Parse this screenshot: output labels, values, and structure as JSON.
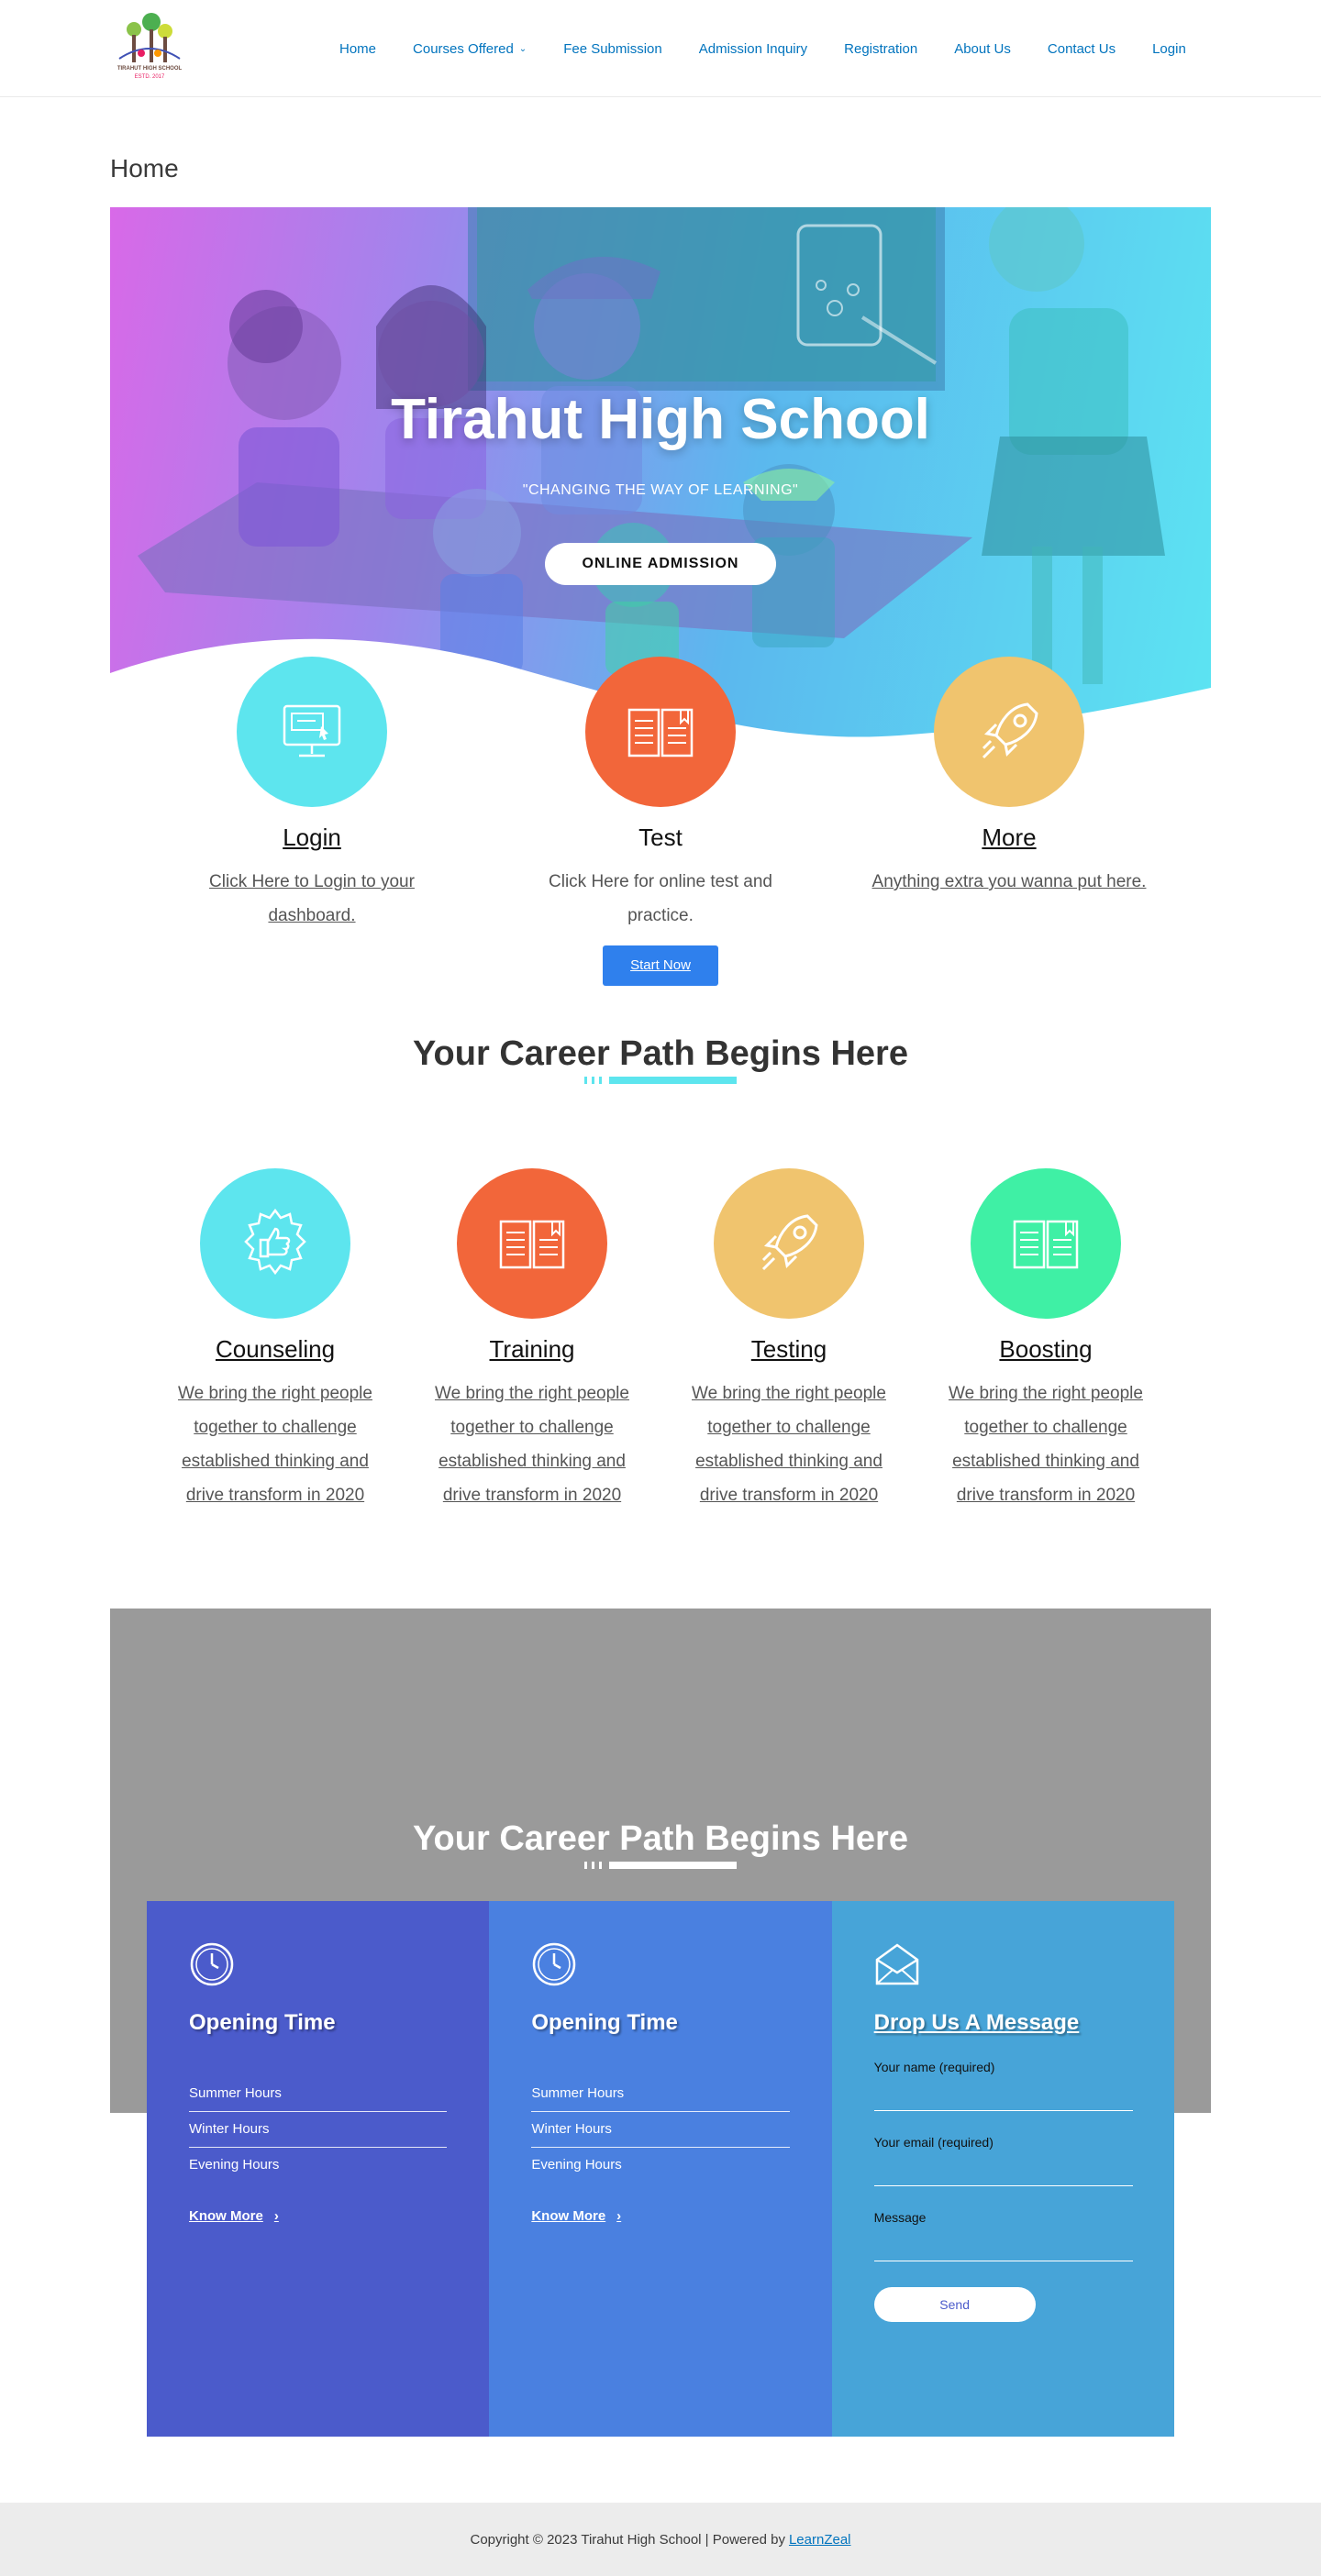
{
  "site": {
    "logo_text": "TIRAHUT HIGH SCHOOL",
    "logo_sub": "ESTD. 2017"
  },
  "nav": {
    "items": [
      {
        "label": "Home"
      },
      {
        "label": "Courses Offered",
        "has_dropdown": true
      },
      {
        "label": "Fee Submission"
      },
      {
        "label": "Admission Inquiry"
      },
      {
        "label": "Registration"
      },
      {
        "label": "About Us"
      },
      {
        "label": "Contact Us"
      },
      {
        "label": "Login"
      }
    ]
  },
  "page": {
    "title": "Home"
  },
  "hero": {
    "title": "Tirahut High School",
    "tagline": "\"CHANGING THE WAY OF LEARNING\"",
    "button": "ONLINE ADMISSION"
  },
  "features": [
    {
      "title": "Login",
      "desc": "Click Here to Login to your dashboard.",
      "icon": "computer-icon",
      "color": "#5de5ee"
    },
    {
      "title": "Test",
      "desc": "Click Here for online test and practice.",
      "icon": "book-icon",
      "color": "#f2663a",
      "button": "Start Now"
    },
    {
      "title": "More",
      "desc": "Anything extra you wanna put here.",
      "icon": "rocket-icon",
      "color": "#f0c46e"
    }
  ],
  "career": {
    "heading": "Your Career Path Begins Here",
    "items": [
      {
        "title": "Counseling",
        "desc": "We bring the right people together to challenge established thinking and drive transform in 2020",
        "icon": "thumbs-up-badge-icon",
        "color": "#5de5ee"
      },
      {
        "title": "Training",
        "desc": "We bring the right people together to challenge established thinking and drive transform in 2020",
        "icon": "book-icon",
        "color": "#f2663a"
      },
      {
        "title": "Testing",
        "desc": "We bring the right people together to challenge established thinking and drive transform in 2020",
        "icon": "rocket-icon",
        "color": "#f0c46e"
      },
      {
        "title": "Boosting",
        "desc": "We bring the right people together to challenge established thinking and drive transform in 2020",
        "icon": "book-icon",
        "color": "#3ff0a5"
      }
    ]
  },
  "career2": {
    "heading": "Your Career Path Begins Here"
  },
  "cards": {
    "opening1": {
      "title": "Opening Time",
      "rows": [
        "Summer Hours",
        "Winter Hours",
        "Evening Hours"
      ],
      "link": "Know More"
    },
    "opening2": {
      "title": "Opening Time",
      "rows": [
        "Summer Hours",
        "Winter Hours",
        "Evening Hours"
      ],
      "link": "Know More"
    },
    "message": {
      "title": "Drop Us A Message",
      "name_label": "Your name (required)",
      "email_label": "Your email (required)",
      "message_label": "Message",
      "send": "Send"
    }
  },
  "colors": {
    "accent": "#0274be",
    "cyan": "#5de5ee",
    "orange": "#f2663a",
    "yellow": "#f0c46e",
    "green": "#3ff0a5",
    "card1": "#4b5bcb",
    "card2": "#4a80e0",
    "card3": "#47a4d8"
  },
  "footer": {
    "text": "Copyright © 2023 Tirahut High School | Powered by",
    "link": "LearnZeal"
  }
}
